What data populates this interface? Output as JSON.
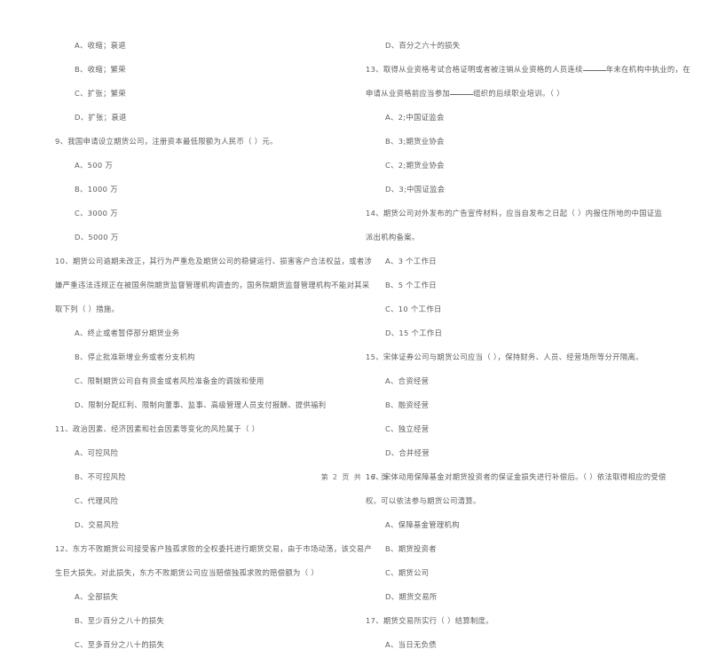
{
  "document": {
    "page_footer": "第 2 页 共 17 页",
    "background_color": "#ffffff",
    "text_color": "#5d5d5d"
  },
  "left_column": {
    "blocks": [
      {
        "kind": "option",
        "text": "A、收缩；衰退"
      },
      {
        "kind": "option",
        "text": "B、收缩；繁荣"
      },
      {
        "kind": "option",
        "text": "C、扩张；繁荣"
      },
      {
        "kind": "option",
        "text": "D、扩张；衰退"
      },
      {
        "kind": "question",
        "text": "9、我国申请设立期货公司，注册资本最低限额为人民币（    ）元。"
      },
      {
        "kind": "option",
        "text": "A、500 万"
      },
      {
        "kind": "option",
        "text": "B、1000 万"
      },
      {
        "kind": "option",
        "text": "C、3000 万"
      },
      {
        "kind": "option",
        "text": "D、5000 万"
      },
      {
        "kind": "question",
        "text": "10、期货公司逾期未改正，其行为严重危及期货公司的稳健运行、损害客户合法权益，或者涉"
      },
      {
        "kind": "continuation",
        "text": "嫌严重违法违规正在被国务院期货监督管理机构调查的，国务院期货监督管理机构不能对其采"
      },
      {
        "kind": "continuation",
        "text": "取下列（    ）措施。"
      },
      {
        "kind": "option",
        "text": "A、终止或者暂停部分期货业务"
      },
      {
        "kind": "option",
        "text": "B、停止批准新增业务或者分支机构"
      },
      {
        "kind": "option",
        "text": "C、限制期货公司自有资金或者风险准备金的调拨和使用"
      },
      {
        "kind": "option",
        "text": "D、限制分配红利、限制向董事、监事、高级管理人员支付报酬、提供福利"
      },
      {
        "kind": "question",
        "text": "11、政治因素、经济因素和社会因素等变化的风险属于（    ）"
      },
      {
        "kind": "option",
        "text": "A、可控风险"
      },
      {
        "kind": "option",
        "text": "B、不可控风险"
      },
      {
        "kind": "option",
        "text": "C、代理风险"
      },
      {
        "kind": "option",
        "text": "D、交易风险"
      },
      {
        "kind": "question",
        "text": "12、东方不败期货公司接受客户独孤求败的全权委托进行期货交易，由于市场动荡，该交易产"
      },
      {
        "kind": "continuation",
        "text": "生巨大损失。对此损失，东方不败期货公司应当赔偿独孤求败的赔偿额为（    ）"
      },
      {
        "kind": "option",
        "text": "A、全部损失"
      },
      {
        "kind": "option",
        "text": "B、至少百分之八十的损失"
      },
      {
        "kind": "option",
        "text": "C、至多百分之八十的损失"
      }
    ]
  },
  "right_column": {
    "blocks": [
      {
        "kind": "option",
        "text": "D、百分之六十的损失"
      },
      {
        "kind": "question_underline",
        "pre": "13、取得从业资格考试合格证明或者被注销从业资格的人员连续",
        "mid": "年未在机构中执业的，在"
      },
      {
        "kind": "continuation_underline",
        "pre": "申请从业资格前应当参加",
        "mid": "组织的后续职业培训。（    ）"
      },
      {
        "kind": "option",
        "text": "A、2;中国证监会"
      },
      {
        "kind": "option",
        "text": "B、3;期货业协会"
      },
      {
        "kind": "option",
        "text": "C、2;期货业协会"
      },
      {
        "kind": "option",
        "text": "D、3;中国证监会"
      },
      {
        "kind": "question",
        "text": "14、期货公司对外发布的广告宣传材料，应当自发布之日起（    ）内报住所地的中国证监"
      },
      {
        "kind": "continuation",
        "text": "派出机构备案。"
      },
      {
        "kind": "option",
        "text": "A、3 个工作日"
      },
      {
        "kind": "option",
        "text": "B、5 个工作日"
      },
      {
        "kind": "option",
        "text": "C、10 个工作日"
      },
      {
        "kind": "option",
        "text": "D、15 个工作日"
      },
      {
        "kind": "question",
        "text": "15、宋体证券公司与期货公司应当（    ），保持财务、人员、经营场所等分开隔离。"
      },
      {
        "kind": "option",
        "text": "A、合资经营"
      },
      {
        "kind": "option",
        "text": "B、融资经营"
      },
      {
        "kind": "option",
        "text": "C、独立经营"
      },
      {
        "kind": "option",
        "text": "D、合并经营"
      },
      {
        "kind": "question",
        "text": "16、宋体动用保障基金对期货投资者的保证金损失进行补偿后。（    ）依法取得相应的受偿"
      },
      {
        "kind": "continuation",
        "text": "权。可以依法参与期货公司清算。"
      },
      {
        "kind": "option",
        "text": "A、保障基金管理机构"
      },
      {
        "kind": "option",
        "text": "B、期货投资者"
      },
      {
        "kind": "option",
        "text": "C、期货公司"
      },
      {
        "kind": "option",
        "text": "D、期货交易所"
      },
      {
        "kind": "question",
        "text": "17、期货交易所实行（    ）结算制度。"
      },
      {
        "kind": "option",
        "text": "A、当日无负债"
      }
    ]
  }
}
